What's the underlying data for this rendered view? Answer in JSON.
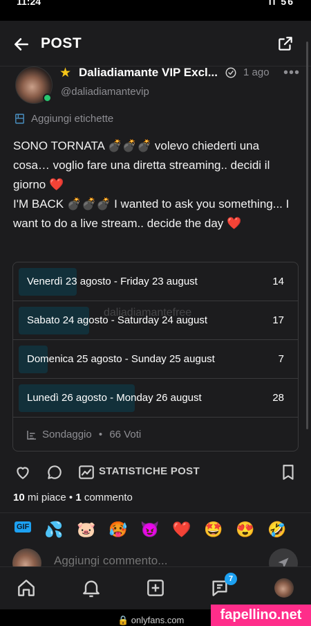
{
  "status_bar": {
    "time": "11:24",
    "system": "ıl 56"
  },
  "appbar": {
    "title": "POST"
  },
  "post": {
    "author_name": "Daliadiamante VIP Excl...",
    "author_handle": "@daliadiamantevip",
    "time": "1 ago",
    "tag_label": "Aggiungi etichette",
    "text_it": "SONO TORNATA 💣💣💣 volevo chiederti una cosa… voglio fare una diretta streaming.. decidi il giorno ❤️",
    "text_en": "I'M BACK 💣💣💣 I wanted to ask you something... I want to do a live stream.. decide the day ❤️"
  },
  "poll": {
    "options": [
      {
        "label": "Venerdì 23 agosto - Friday 23 august",
        "votes": "14",
        "share": 0.212
      },
      {
        "label": "Sabato 24 agosto - Saturday 24 august",
        "votes": "17",
        "share": 0.258
      },
      {
        "label": "Domenica 25 agosto - Sunday 25 august",
        "votes": "7",
        "share": 0.106
      },
      {
        "label": "Lunedì 26 agosto - Monday 26 august",
        "votes": "28",
        "share": 0.424
      }
    ],
    "type_label": "Sondaggio",
    "separator": "•",
    "votes_label": "66 Voti",
    "watermark": "daliadiamantefree"
  },
  "actions": {
    "like_icon": "heart-icon",
    "comment_icon": "comment-bubble-icon",
    "stats_icon": "chart-icon",
    "stats_label": "STATISTICHE POST",
    "bookmark_icon": "bookmark-icon"
  },
  "engagement": {
    "likes_count": "10",
    "likes_text": " mi piace",
    "separator": " • ",
    "comments_count": "1",
    "comments_text": " commento"
  },
  "emoji_bar": {
    "gif_label": "GIF",
    "emojis": [
      "💦",
      "🐷",
      "🥵",
      "😈",
      "❤️",
      "🤩",
      "😍",
      "🤣"
    ]
  },
  "comment": {
    "placeholder": "Aggiungi commento..."
  },
  "bottom_nav": {
    "messages_badge": "7"
  },
  "browser": {
    "url": "🔒 onlyfans.com"
  },
  "overlay": {
    "brand": "fapellino.net"
  },
  "colors": {
    "accent": "#1da1f2",
    "online": "#28c76f",
    "background": "#1c1c1e",
    "watermark_bg": "#ff2d8a"
  }
}
